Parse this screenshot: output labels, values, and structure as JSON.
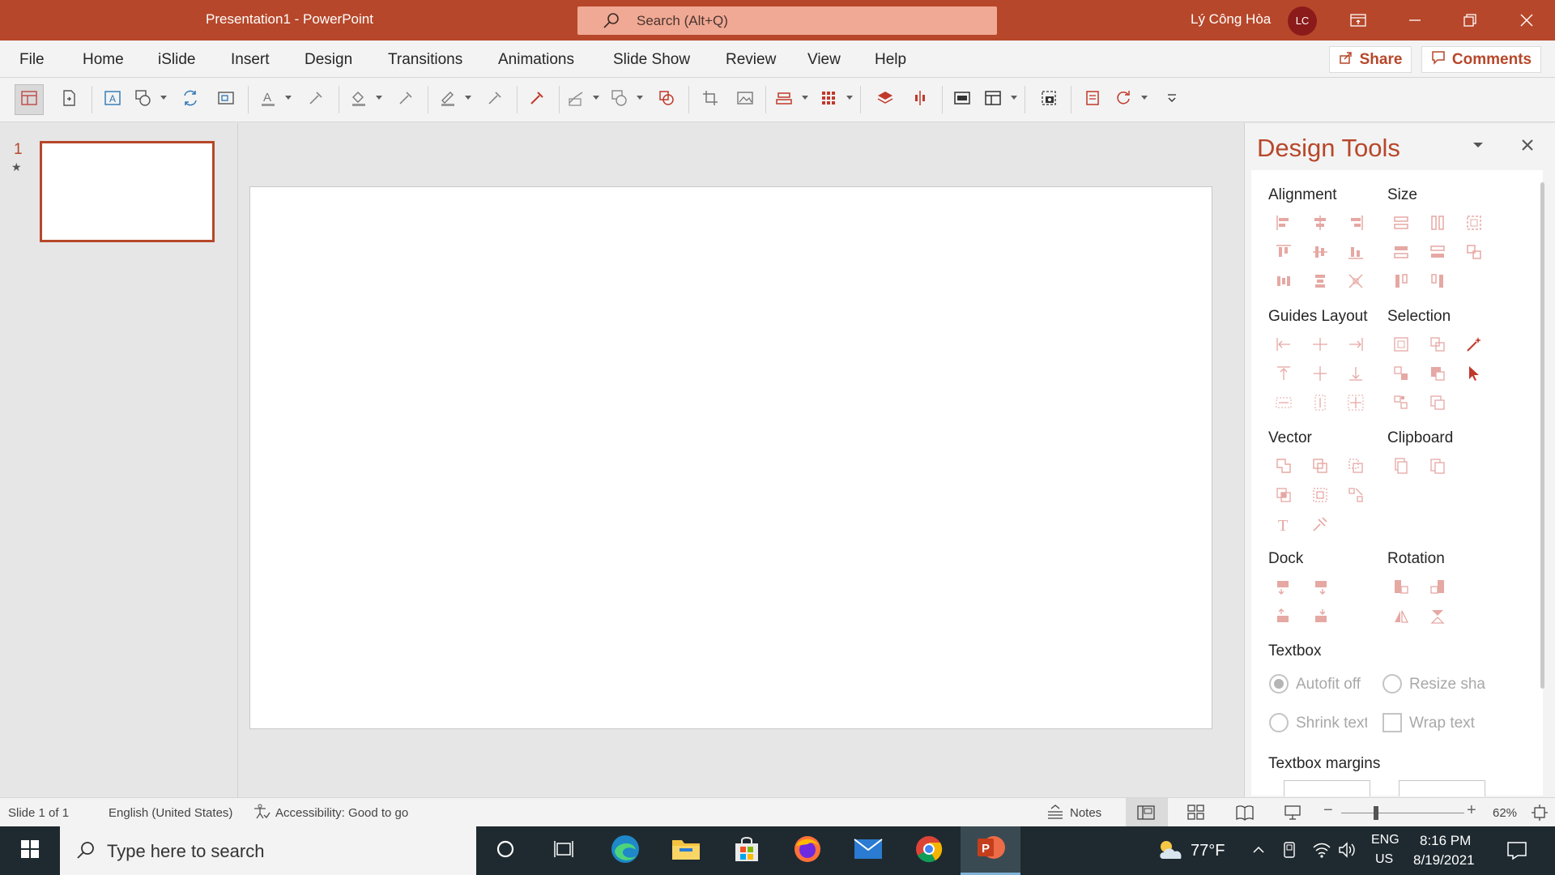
{
  "window": {
    "title": "Presentation1  -  PowerPoint",
    "search_placeholder": "Search (Alt+Q)",
    "user_name": "Lý Công Hòa",
    "user_initials": "LC"
  },
  "menu": {
    "items": [
      "File",
      "Home",
      "iSlide",
      "Insert",
      "Design",
      "Transitions",
      "Animations",
      "Slide Show",
      "Review",
      "View",
      "Help"
    ],
    "share_label": "Share",
    "comments_label": "Comments"
  },
  "thumbnails": {
    "slide_number": "1",
    "star": "★"
  },
  "design_tools": {
    "title": "Design Tools",
    "sections": {
      "alignment": "Alignment",
      "size": "Size",
      "guides_layout": "Guides Layout",
      "selection": "Selection",
      "vector": "Vector",
      "clipboard": "Clipboard",
      "dock": "Dock",
      "rotation": "Rotation",
      "textbox": "Textbox",
      "textbox_margins": "Textbox margins"
    },
    "textbox_options": {
      "autofit_off": "Autofit off",
      "resize_shape": "Resize sha",
      "shrink_text": "Shrink text",
      "wrap_text": "Wrap text"
    }
  },
  "status": {
    "slide_info": "Slide 1 of 1",
    "language": "English (United States)",
    "accessibility": "Accessibility: Good to go",
    "notes_label": "Notes",
    "zoom": "62%"
  },
  "taskbar": {
    "search_placeholder": "Type here to search",
    "weather": "77°F",
    "lang_1": "ENG",
    "lang_2": "US",
    "time": "8:16 PM",
    "date": "8/19/2021"
  },
  "colors": {
    "accent": "#b7472a",
    "taskbar": "#1f2a30"
  }
}
